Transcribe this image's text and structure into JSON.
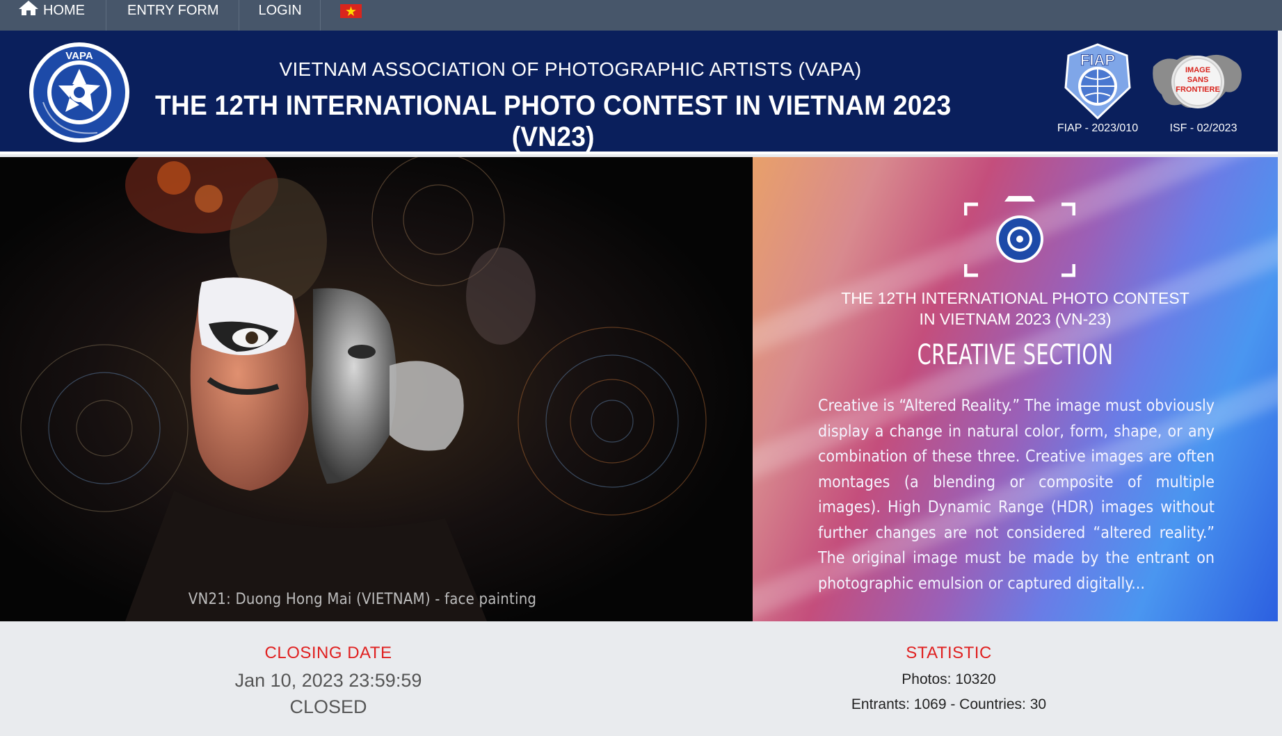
{
  "nav": {
    "home_label": "HOME",
    "entry_form_label": "ENTRY FORM",
    "login_label": "LOGIN",
    "home_icon": "home-icon",
    "flag_icon": "vietnam-flag-icon"
  },
  "header": {
    "org_name": "VIETNAM ASSOCIATION OF PHOTOGRAPHIC ARTISTS (VAPA)",
    "contest_title": "THE 12TH INTERNATIONAL PHOTO CONTEST IN VIETNAM 2023 (VN23)",
    "vapa_logo_text": "VAPA",
    "fiap_logo_text": "FIAP",
    "fiap_caption": "FIAP - 2023/010",
    "isf_logo_text": "IMAGE SANS FRONTIERE",
    "isf_caption": "ISF - 02/2023",
    "brand_color": "#0a1f5c"
  },
  "photo": {
    "caption": "VN21:  Duong Hong Mai (VIETNAM) - face painting"
  },
  "info": {
    "title_line1": "THE 12TH INTERNATIONAL PHOTO CONTEST",
    "title_line2": "IN VIETNAM 2023 (VN-23)",
    "section_name": "CREATIVE SECTION",
    "description": "Creative is “Altered Reality.” The image must obviously display a change in natural color, form, shape, or any combination of these three. Creative images are often montages (a blending or composite of multiple images). High Dynamic Range (HDR) images without further changes are not considered “altered reality.” The original image must be made by the entrant on photographic emulsion or captured digitally..."
  },
  "closing": {
    "label": "CLOSING DATE",
    "date": "Jan 10, 2023 23:59:59",
    "status": "CLOSED"
  },
  "statistic": {
    "label": "STATISTIC",
    "photos": "Photos: 10320",
    "entrants": "Entrants: 1069 - Countries: 30"
  },
  "colors": {
    "nav_bg": "#47566a",
    "accent_red": "#e02020"
  }
}
